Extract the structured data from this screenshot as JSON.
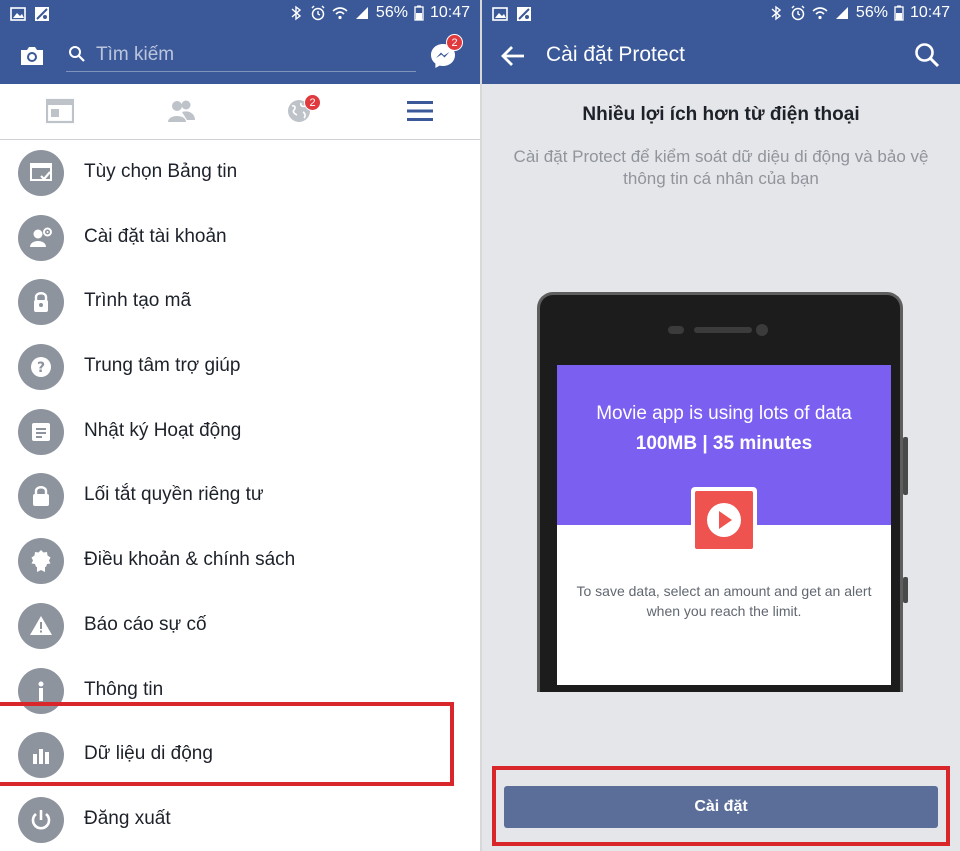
{
  "status_bar": {
    "battery": "56%",
    "time": "10:47"
  },
  "left": {
    "search_placeholder": "Tìm kiếm",
    "messenger_badge": "2",
    "notifications_badge": "2",
    "tabs": [
      "feed-icon",
      "friends-icon",
      "globe-icon",
      "menu-icon"
    ],
    "menu_items": [
      {
        "label": "Tùy chọn Bảng tin",
        "icon": "feed-preferences-icon"
      },
      {
        "label": "Cài đặt tài khoản",
        "icon": "account-settings-icon"
      },
      {
        "label": "Trình tạo mã",
        "icon": "lock-icon"
      },
      {
        "label": "Trung tâm trợ giúp",
        "icon": "help-icon"
      },
      {
        "label": "Nhật ký Hoạt động",
        "icon": "activity-log-icon"
      },
      {
        "label": "Lối tắt quyền riêng tư",
        "icon": "privacy-lock-icon"
      },
      {
        "label": "Điều khoản & chính sách",
        "icon": "badge-icon"
      },
      {
        "label": "Báo cáo sự cố",
        "icon": "warning-icon"
      },
      {
        "label": "Thông tin",
        "icon": "info-icon"
      },
      {
        "label": "Dữ liệu di động",
        "icon": "bar-chart-icon"
      },
      {
        "label": "Đăng xuất",
        "icon": "power-icon"
      }
    ]
  },
  "right": {
    "title": "Cài đặt Protect",
    "heading": "Nhiều lợi ích hơn từ điện thoại",
    "subtext": "Cài đặt Protect để kiểm soát dữ diệu di động và bảo vệ thông tin cá nhân của bạn",
    "phone_line1": "Movie app is using lots of data",
    "phone_line2": "100MB | 35 minutes",
    "phone_line3": "To save data, select an amount and get an alert when you reach the limit.",
    "install_button": "Cài đặt"
  },
  "colors": {
    "brand": "#3b5998",
    "highlight": "#d9262b",
    "purple": "#7b5ff1",
    "play_red": "#ef5350",
    "button": "#5b6e99"
  }
}
